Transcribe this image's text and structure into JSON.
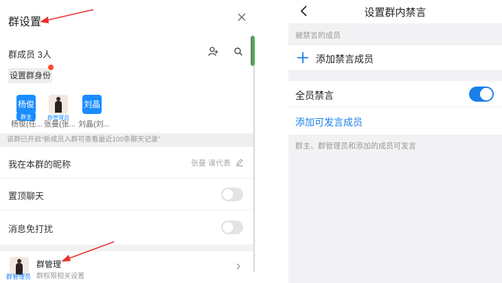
{
  "left_panel": {
    "title": "群设置",
    "members_label": "群成员 3人",
    "set_role_button": "设置群身份",
    "members": [
      {
        "avatar_text": "杨俊",
        "role": "群主",
        "name": "杨俊(任..."
      },
      {
        "avatar_text": "",
        "role": "群管理员",
        "name": "张曼(张..."
      },
      {
        "avatar_text": "刘晶",
        "role": "",
        "name": "刘晶(刘..."
      }
    ],
    "notice": "该群已开启“新成员入群可查看最近100条聊天记录”",
    "nickname_label": "我在本群的昵称",
    "nickname_value": "张曼 课代表",
    "pin_chat_label": "置顶聊天",
    "mute_notify_label": "消息免打扰",
    "management": {
      "tag": "群管理员",
      "title": "群管理",
      "subtitle": "群权限相关设置"
    },
    "toggles": {
      "pin_chat": false,
      "mute_notify": false
    }
  },
  "right_panel": {
    "title": "设置群内禁言",
    "section_label": "被禁言的成员",
    "add_muted_label": "添加禁言成员",
    "mute_all_label": "全员禁言",
    "mute_all_on": true,
    "add_speak_label": "添加可发言成员",
    "note": "群主、群管理员和添加的成员可发言"
  },
  "colors": {
    "accent": "#1a7fe8",
    "annotation_arrow": "#e8322a",
    "badge_dot": "#ff4d2e"
  },
  "icons": [
    "close-icon",
    "add-person-icon",
    "search-icon",
    "edit-icon",
    "chevron-right-icon",
    "back-icon",
    "plus-icon"
  ]
}
